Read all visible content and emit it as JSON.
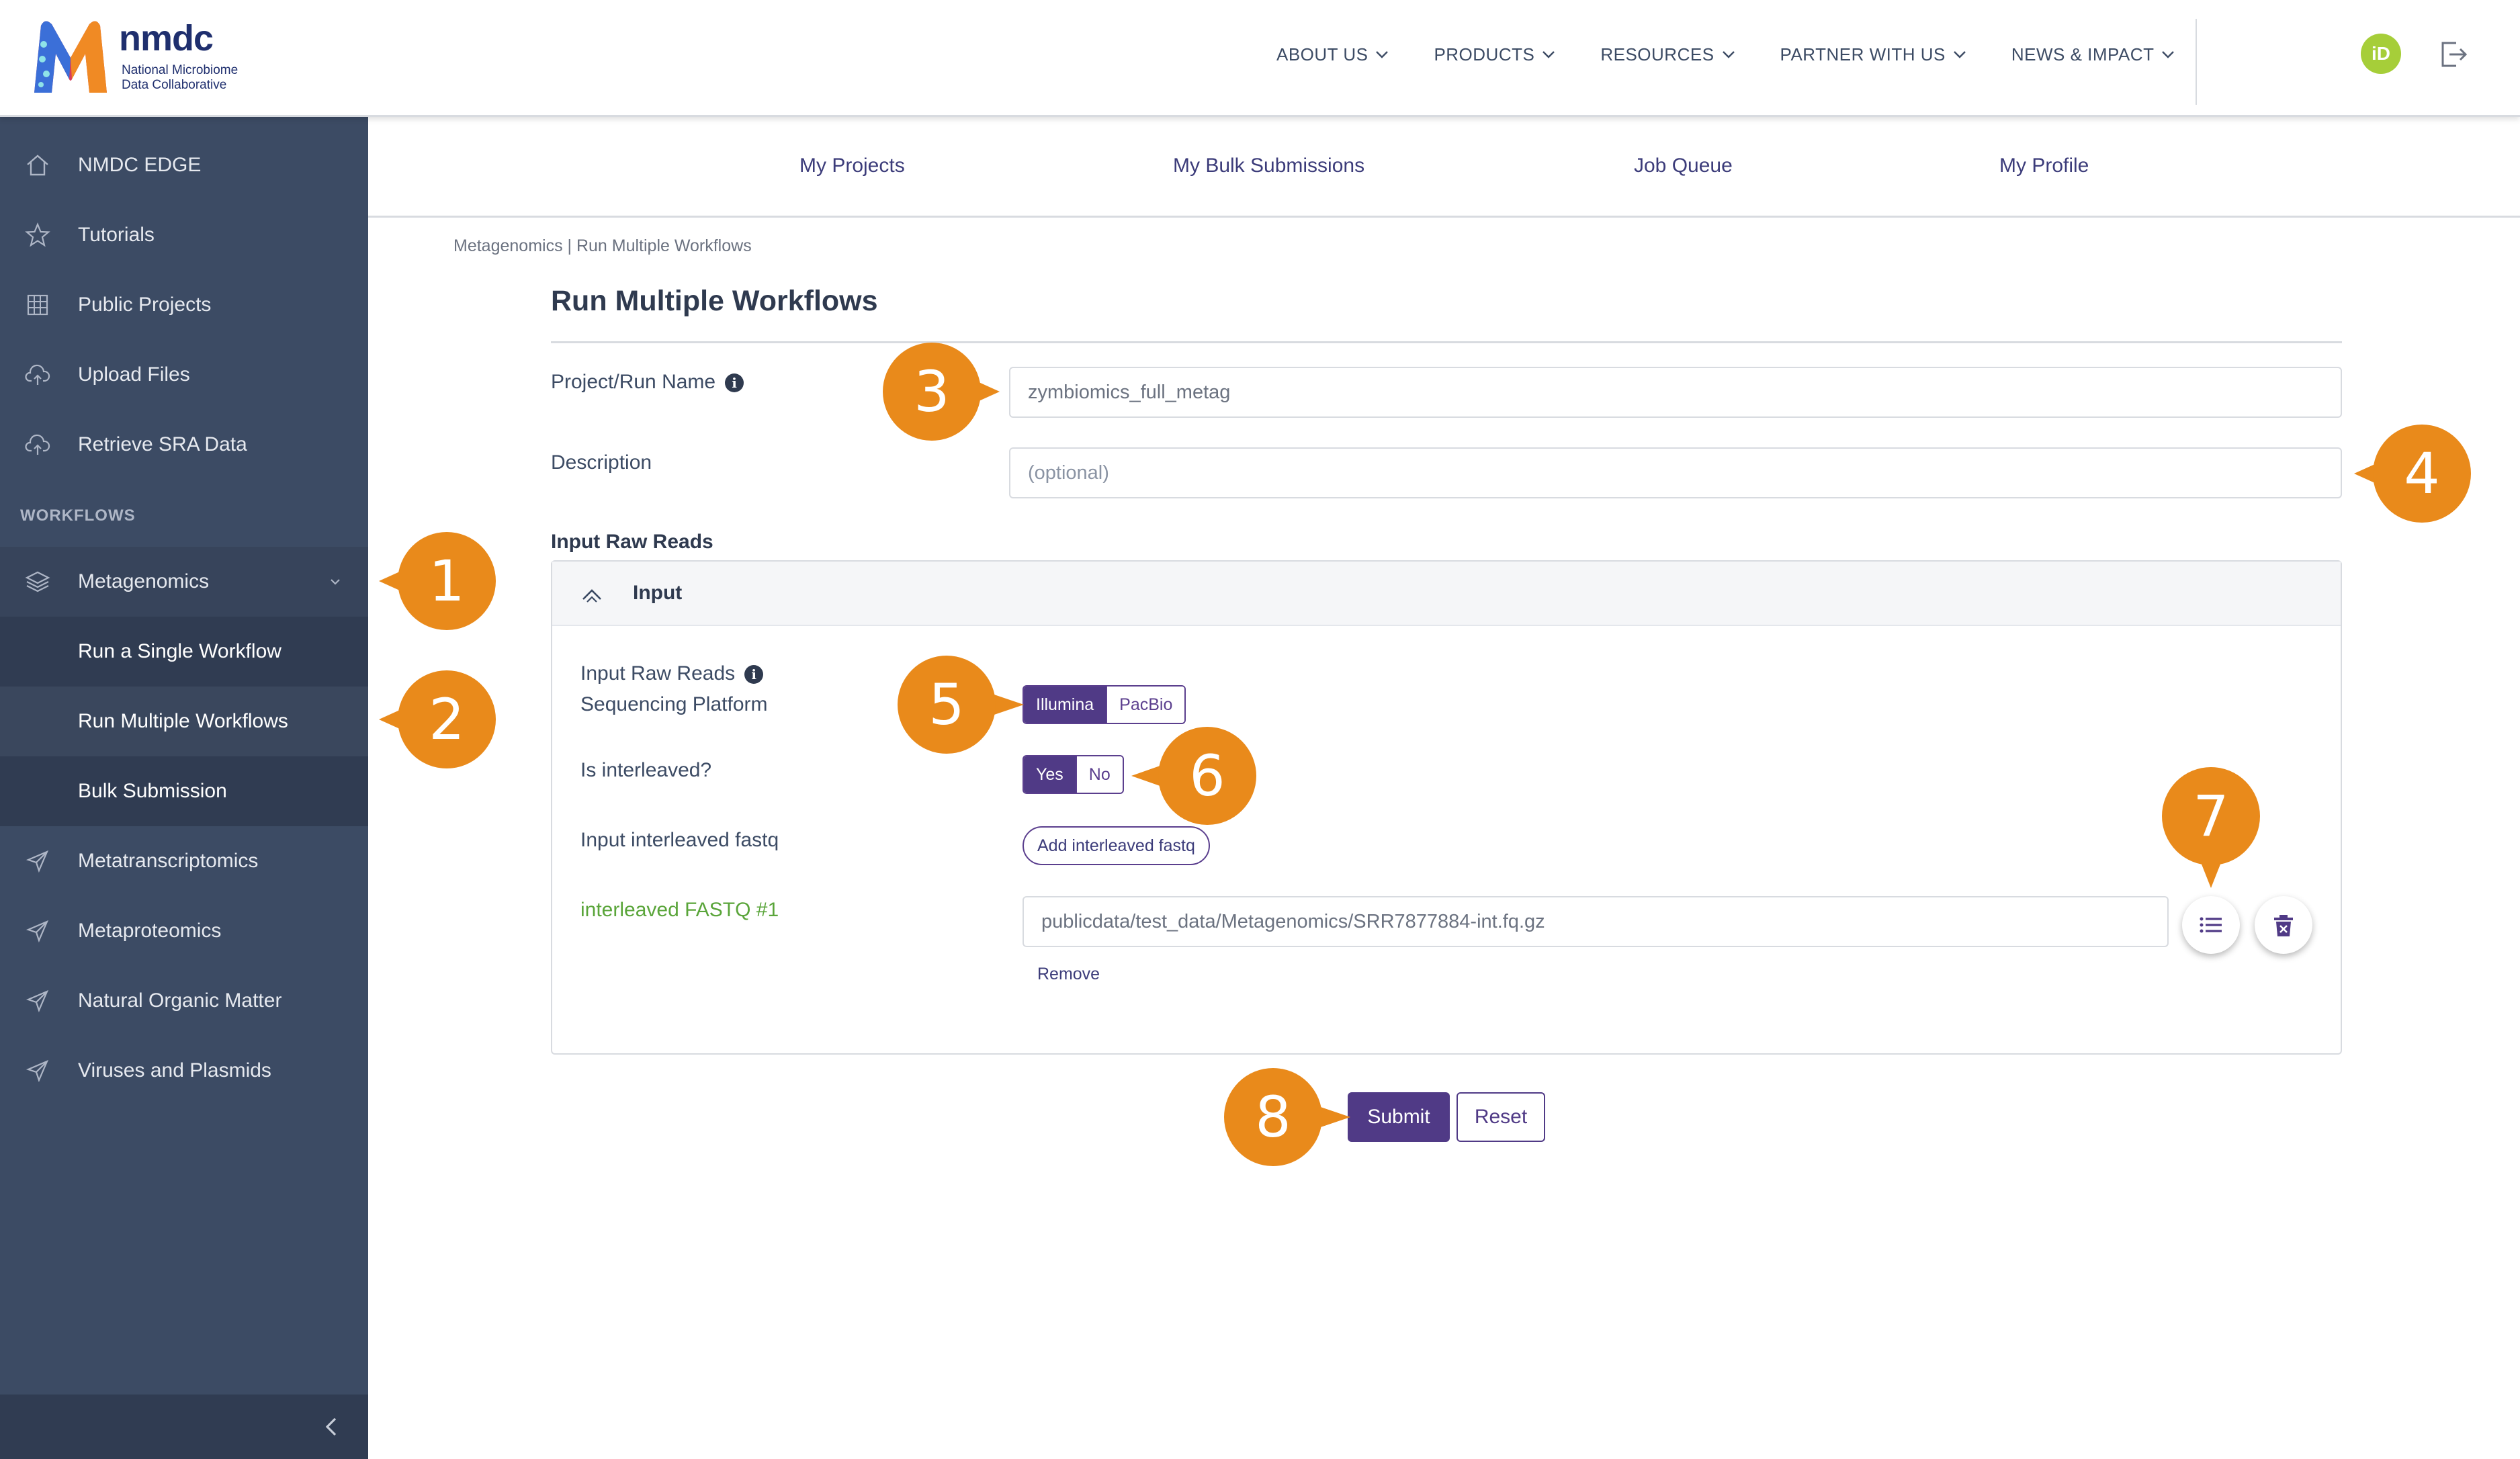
{
  "brand": {
    "name": "nmdc",
    "subtitle_line1": "National Microbiome",
    "subtitle_line2": "Data Collaborative",
    "colors": {
      "primary": "#503a86",
      "sidebar": "#3c4b64",
      "callout": "#e98a1b",
      "orcid": "#a6ce39",
      "success_text": "#5aa53a"
    }
  },
  "topnav": {
    "items": [
      {
        "label": "ABOUT US",
        "icon": "chevron-down-icon"
      },
      {
        "label": "PRODUCTS",
        "icon": "chevron-down-icon"
      },
      {
        "label": "RESOURCES",
        "icon": "chevron-down-icon"
      },
      {
        "label": "PARTNER WITH US",
        "icon": "chevron-down-icon"
      },
      {
        "label": "NEWS & IMPACT",
        "icon": "chevron-down-icon"
      }
    ],
    "orcid_label": "iD",
    "logout_icon": "logout-icon"
  },
  "sidebar": {
    "items": [
      {
        "label": "NMDC EDGE",
        "icon": "home-icon"
      },
      {
        "label": "Tutorials",
        "icon": "star-icon"
      },
      {
        "label": "Public Projects",
        "icon": "grid-icon"
      },
      {
        "label": "Upload Files",
        "icon": "cloud-upload-icon"
      },
      {
        "label": "Retrieve SRA Data",
        "icon": "cloud-upload-icon"
      }
    ],
    "section_title": "WORKFLOWS",
    "workflows": [
      {
        "label": "Metagenomics",
        "icon": "layers-icon",
        "expanded": true
      },
      {
        "label": "Run a Single Workflow"
      },
      {
        "label": "Run Multiple Workflows",
        "active": true
      },
      {
        "label": "Bulk Submission"
      },
      {
        "label": "Metatranscriptomics",
        "icon": "send-icon"
      },
      {
        "label": "Metaproteomics",
        "icon": "send-icon"
      },
      {
        "label": "Natural Organic Matter",
        "icon": "send-icon"
      },
      {
        "label": "Viruses and Plasmids",
        "icon": "send-icon"
      }
    ],
    "collapse_icon": "chevron-left-icon"
  },
  "subnav": {
    "items": [
      "My Projects",
      "My Bulk Submissions",
      "Job Queue",
      "My Profile"
    ]
  },
  "page": {
    "breadcrumb": "Metagenomics | Run Multiple Workflows",
    "title": "Run Multiple Workflows",
    "project_label": "Project/Run Name",
    "project_value": "zymbiomics_full_metag",
    "description_label": "Description",
    "description_placeholder": "(optional)",
    "section_title": "Input Raw Reads",
    "card_title": "Input",
    "platform_label_line1": "Input Raw Reads",
    "platform_label_line2": "Sequencing Platform",
    "platform_options": [
      "Illumina",
      "PacBio"
    ],
    "platform_selected": "Illumina",
    "interleaved_label": "Is interleaved?",
    "interleaved_options": [
      "Yes",
      "No"
    ],
    "interleaved_selected": "Yes",
    "fastq_label": "Input interleaved fastq",
    "add_fastq_button": "Add interleaved fastq",
    "fastq_item_label": "interleaved FASTQ #1",
    "fastq_item_value": "publicdata/test_data/Metagenomics/SRR7877884-int.fq.gz",
    "browse_icon": "list-icon",
    "delete_icon": "trash-icon",
    "remove_link": "Remove",
    "submit_button": "Submit",
    "reset_button": "Reset"
  },
  "callouts": [
    "1",
    "2",
    "3",
    "4",
    "5",
    "6",
    "7",
    "8"
  ]
}
